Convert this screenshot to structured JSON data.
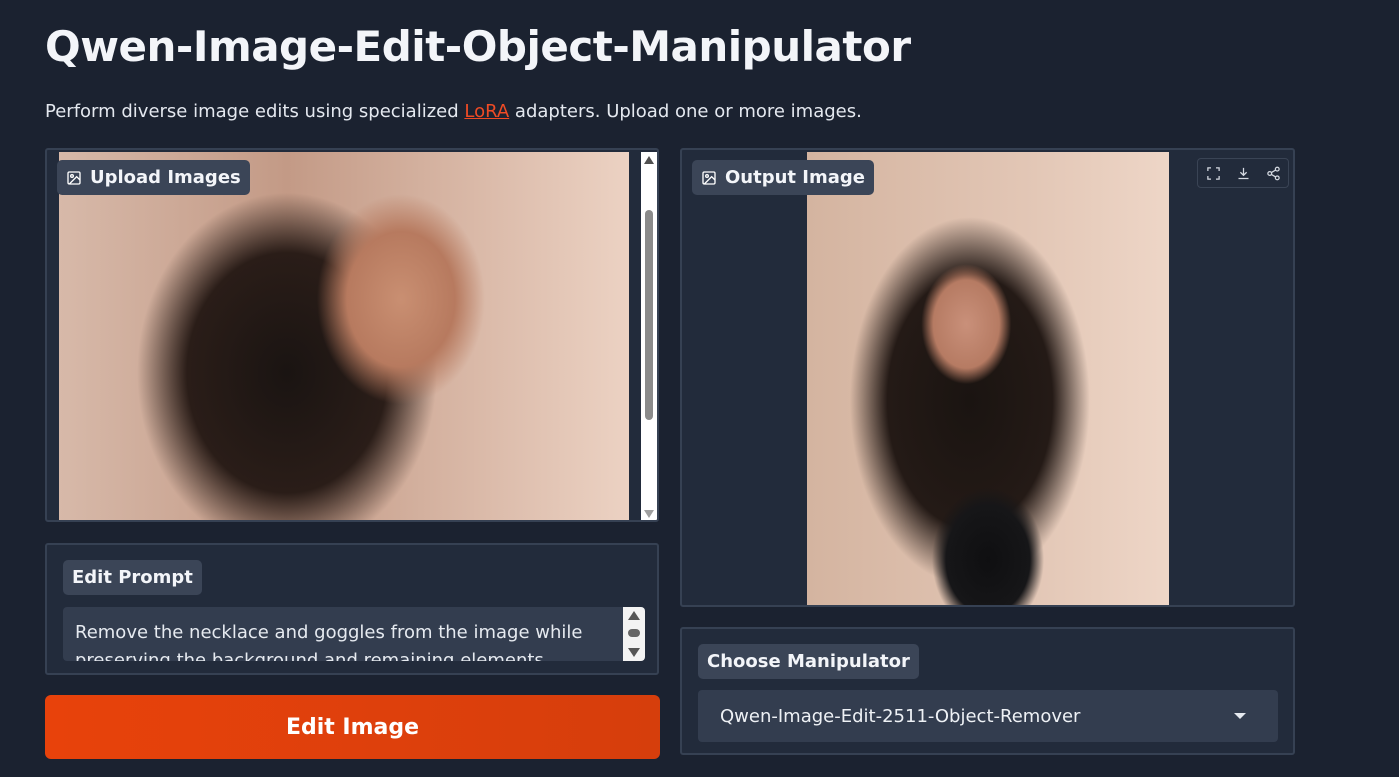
{
  "header": {
    "title": "Qwen-Image-Edit-Object-Manipulator",
    "subtitle_before": "Perform diverse image edits using specialized ",
    "subtitle_link": "LoRA",
    "subtitle_after": " adapters. Upload one or more images."
  },
  "upload": {
    "label": "Upload Images",
    "icon": "image-icon"
  },
  "prompt": {
    "label": "Edit Prompt",
    "value": "Remove the necklace and goggles from the image while preserving the background and remaining elements."
  },
  "button": {
    "label": "Edit Image"
  },
  "output": {
    "label": "Output Image",
    "icon": "image-icon",
    "tools": [
      "fullscreen-icon",
      "download-icon",
      "share-icon"
    ]
  },
  "manipulator": {
    "label": "Choose Manipulator",
    "selected": "Qwen-Image-Edit-2511-Object-Remover"
  },
  "colors": {
    "background": "#1b2230",
    "panel": "#222b3b",
    "accent": "#e8420b",
    "link": "#ef4b25"
  }
}
